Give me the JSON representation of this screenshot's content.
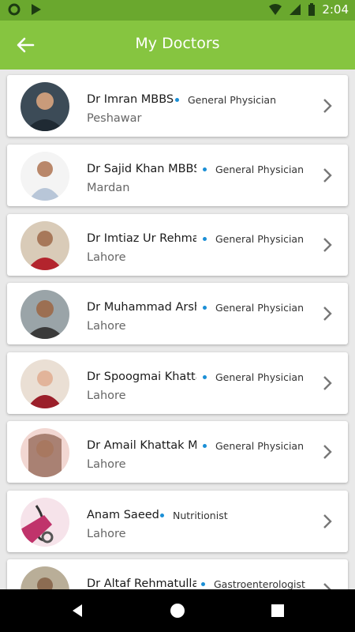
{
  "status": {
    "time": "2:04"
  },
  "appbar": {
    "title": "My Doctors"
  },
  "doctors": [
    {
      "name": "Dr Imran MBBS",
      "specialty": "General Physician",
      "city": "Peshawar"
    },
    {
      "name": "Dr Sajid Khan MBBS I",
      "specialty": "General Physician",
      "city": "Mardan"
    },
    {
      "name": "Dr Imtiaz Ur Rehman",
      "specialty": "General Physician",
      "city": "Lahore"
    },
    {
      "name": "Dr Muhammad Arsha",
      "specialty": "General Physician",
      "city": "Lahore"
    },
    {
      "name": "Dr Spoogmai Khattak",
      "specialty": "General Physician",
      "city": "Lahore"
    },
    {
      "name": "Dr Amail Khattak MB",
      "specialty": "General Physician",
      "city": "Lahore"
    },
    {
      "name": "Anam Saeed",
      "specialty": "Nutritionist",
      "city": "Lahore"
    },
    {
      "name": "Dr Altaf Rehmatullah",
      "specialty": "Gastroenterologist",
      "city": ""
    }
  ]
}
